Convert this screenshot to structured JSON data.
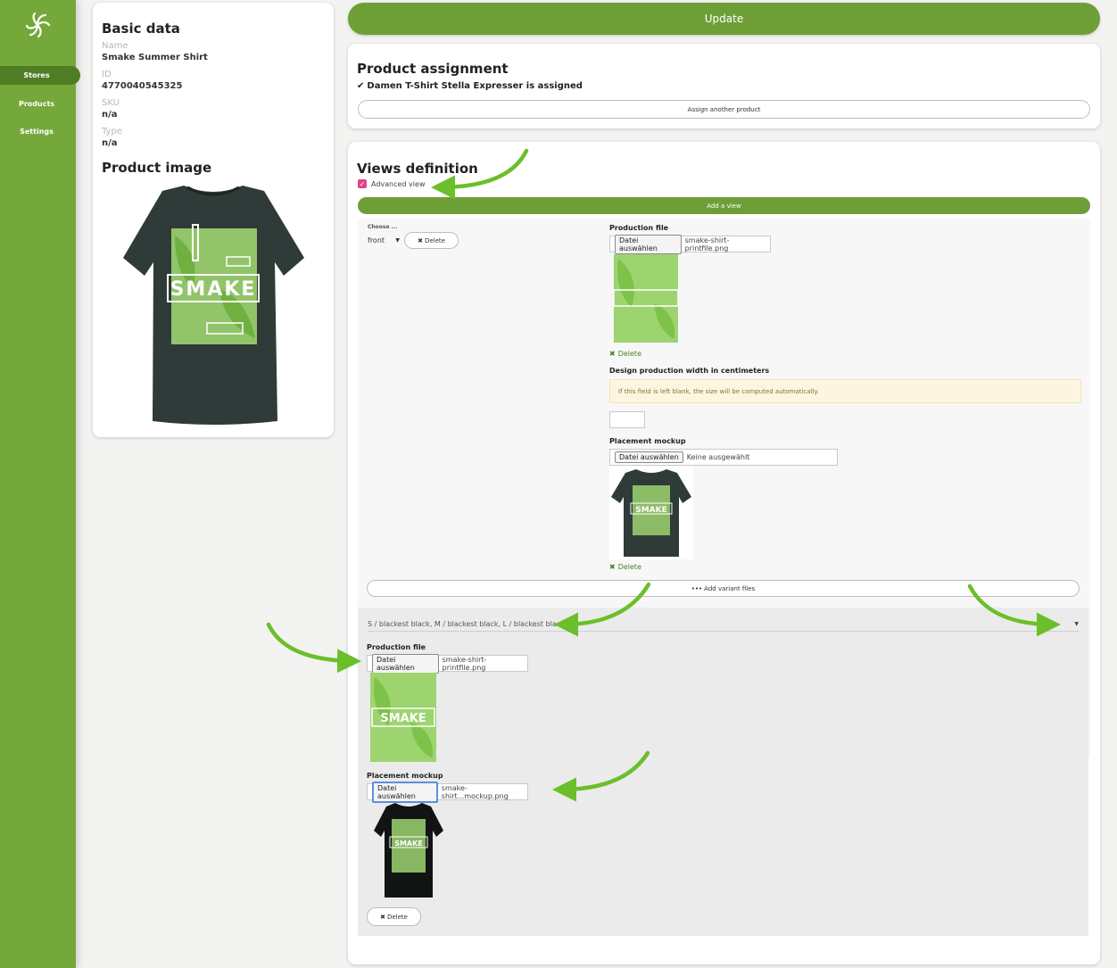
{
  "sidebar": {
    "logo_icon": "swirl-logo-icon",
    "items": [
      {
        "label": "Stores",
        "active": true
      },
      {
        "label": "Products",
        "active": false
      },
      {
        "label": "Settings",
        "active": false
      }
    ]
  },
  "basic_data": {
    "title": "Basic data",
    "fields": [
      {
        "label": "Name",
        "value": "Smake Summer Shirt"
      },
      {
        "label": "ID",
        "value": "4770040545325"
      },
      {
        "label": "SKU",
        "value": "n/a"
      },
      {
        "label": "Type",
        "value": "n/a"
      }
    ],
    "product_image_title": "Product image",
    "shirt_text": "SMAKE"
  },
  "update_label": "Update",
  "assignment": {
    "title": "Product assignment",
    "status_text": "Damen T-Shirt Stella Expresser is assigned",
    "assign_button": "Assign another product"
  },
  "views": {
    "title": "Views definition",
    "advanced_view_label": "Advanced view",
    "advanced_view_checked": true,
    "add_view_button": "Add a view",
    "choose_label": "Choose ...",
    "view_select_value": "front",
    "delete_label": "Delete",
    "production_file_label": "Production file",
    "file_button_label": "Datei auswählen",
    "production_file_name": "smake-shirt-printfile.png",
    "width_label": "Design production width in centimeters",
    "width_hint": "If this field is left blank, the size will be computed automatically.",
    "width_value": "",
    "placement_mockup_label": "Placement mockup",
    "placement_file_name": "Keine ausgewählt",
    "add_variant_button": "Add variant files",
    "variant": {
      "select_value": "S / blackest black, M / blackest black, L / blackest black",
      "production_file_label": "Production file",
      "production_file_name": "smake-shirt-printfile.png",
      "placement_mockup_label": "Placement mockup",
      "placement_file_name": "smake-shirt...mockup.png",
      "delete_label": "Delete"
    }
  },
  "colors": {
    "sidebar": "#74a83a",
    "accent": "#6e9f37",
    "accent_dark": "#4f7d24",
    "hint_bg": "#fcf6e1",
    "shirt": "#2f3b38",
    "print_green": "#9dd470"
  }
}
